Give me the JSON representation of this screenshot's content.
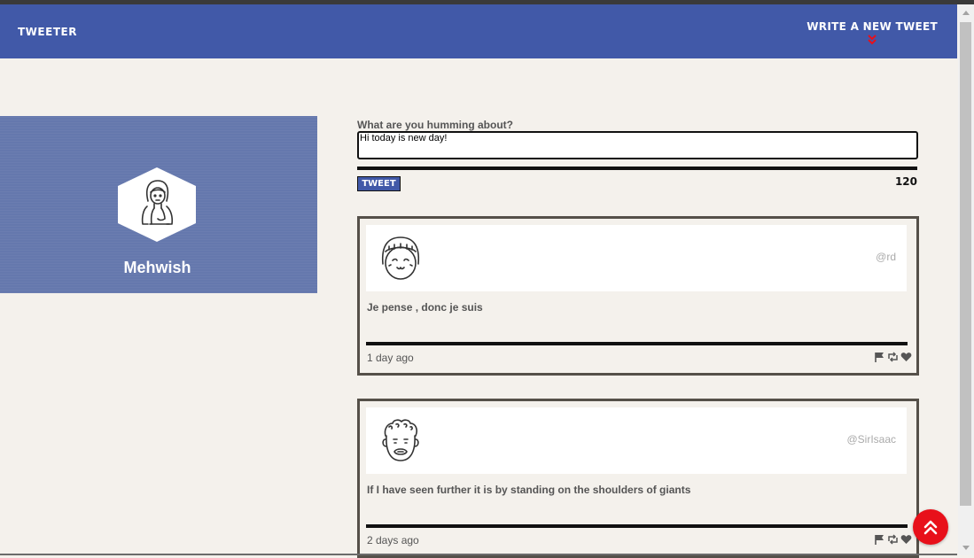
{
  "nav": {
    "brand": "TWEETER",
    "write_label": "WRITE A NEW TWEET",
    "write_icon": "double-chevron-down-icon",
    "accent": "#4159a8",
    "chevron_color": "#e8101a"
  },
  "profile": {
    "name": "Mehwish",
    "avatar_icon": "woman-avatar-icon",
    "background": "#6578ad"
  },
  "composer": {
    "label": "What are you humming about?",
    "value": "Hi today is new day!",
    "button_label": "TWEET",
    "counter": "120"
  },
  "tweets": [
    {
      "avatar_icon": "girl-avatar-icon",
      "handle": "@rd",
      "text": "Je pense , donc je suis",
      "time": "1 day ago",
      "actions": [
        "flag-icon",
        "retweet-icon",
        "heart-icon"
      ]
    },
    {
      "avatar_icon": "curly-hair-man-avatar-icon",
      "handle": "@SirIsaac",
      "text": "If I have seen further it is by standing on the shoulders of giants",
      "time": "2 days ago",
      "actions": [
        "flag-icon",
        "retweet-icon",
        "heart-icon"
      ]
    }
  ],
  "scroll_top_button": {
    "icon": "double-chevron-up-icon",
    "color": "#e8101a"
  }
}
